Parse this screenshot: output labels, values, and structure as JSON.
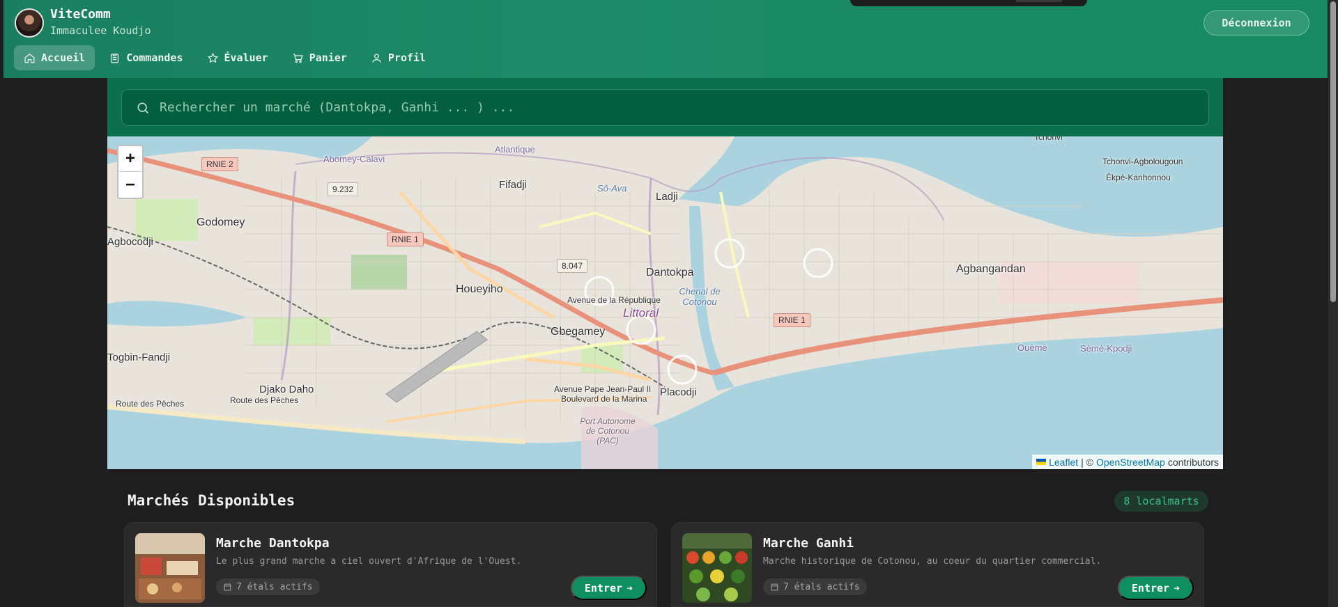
{
  "app": {
    "brand": "ViteComm",
    "user_name": "Immaculee Koudjo",
    "logout_label": "Déconnexion"
  },
  "nav": {
    "items": [
      {
        "label": "Accueil",
        "icon": "home-icon",
        "active": true
      },
      {
        "label": "Commandes",
        "icon": "clipboard-icon",
        "active": false
      },
      {
        "label": "Évaluer",
        "icon": "star-icon",
        "active": false
      },
      {
        "label": "Panier",
        "icon": "cart-icon",
        "active": false
      },
      {
        "label": "Profil",
        "icon": "user-icon",
        "active": false
      }
    ]
  },
  "search": {
    "placeholder": "Rechercher un marché (Dantokpa, Ganhi ... ) ..."
  },
  "map": {
    "zoom_in": "+",
    "zoom_out": "−",
    "attribution": {
      "leaflet": "Leaflet",
      "separator": "| ©",
      "osm": "OpenStreetMap",
      "suffix": "contributors"
    },
    "places": {
      "godomey": "Godomey",
      "agbocodji": "Agbocodji",
      "fifadji": "Fifadji",
      "ladji": "Ladji",
      "dantokpa": "Dantokpa",
      "houeyiho": "Houeyiho",
      "littoral": "Littoral",
      "gbegamey": "Gbegamey",
      "agbangandan": "Agbangandan",
      "togbin": "Togbin-Fandji",
      "djako": "Djako Daho",
      "placodji": "Placodji",
      "tchonvi": "Tchonvi",
      "tchonvi_ag": "Tchonvi-Agbolougoun",
      "ekpe": "Ékpè-Kanhonnou",
      "ouemel": "Ouèmè",
      "seme": "Sèmè-Kpodji",
      "abomey": "Abomey-Calavi",
      "port": "Port Autonome de Cotonou (PAC)",
      "chenal": "Chenal de Cotonou",
      "route_peches": "Route des Pêches",
      "av_jp2": "Avenue Pape Jean-Paul II",
      "bd_marina": "Boulevard de la Marina",
      "av_rep": "Avenue de la République",
      "atlantique": "Atlantique",
      "so_ava": "Sô-Ava"
    },
    "shields": {
      "rnie2": "RNIE 2",
      "rnie1": "RNIE 1",
      "rnie1b": "RNIE 1",
      "r9232": "9.232",
      "r8047": "8.047"
    }
  },
  "markets": {
    "title": "Marchés Disponibles",
    "count_label": "8 localmarts",
    "items": [
      {
        "name": "Marche Dantokpa",
        "description": "Le plus grand marche a ciel ouvert d'Afrique de l'Ouest.",
        "stalls": "7 étals actifs",
        "enter": "Entrer"
      },
      {
        "name": "Marche Ganhi",
        "description": "Marche historique de Cotonou, au coeur du quartier commercial.",
        "stalls": "7 étals actifs",
        "enter": "Entrer"
      }
    ]
  },
  "colors": {
    "header_green": "#1a7f5f",
    "accent": "#0f8f5f",
    "background": "#1e1e1e"
  }
}
